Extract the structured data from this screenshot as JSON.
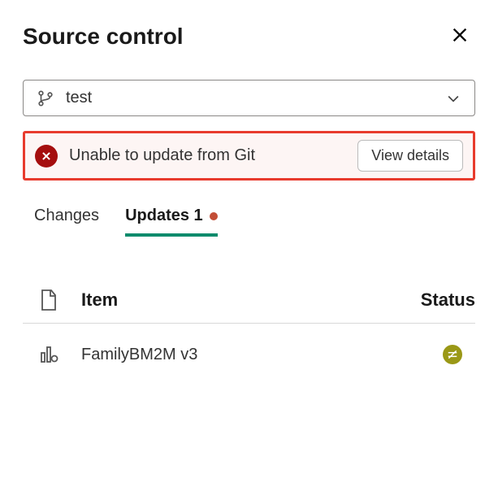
{
  "header": {
    "title": "Source control"
  },
  "dropdown": {
    "selected": "test"
  },
  "error": {
    "message": "Unable to update from Git",
    "action_label": "View details"
  },
  "tabs": {
    "changes_label": "Changes",
    "updates_label": "Updates 1"
  },
  "table": {
    "col_item": "Item",
    "col_status": "Status",
    "rows": [
      {
        "name": "FamilyBM2M v3"
      }
    ]
  }
}
